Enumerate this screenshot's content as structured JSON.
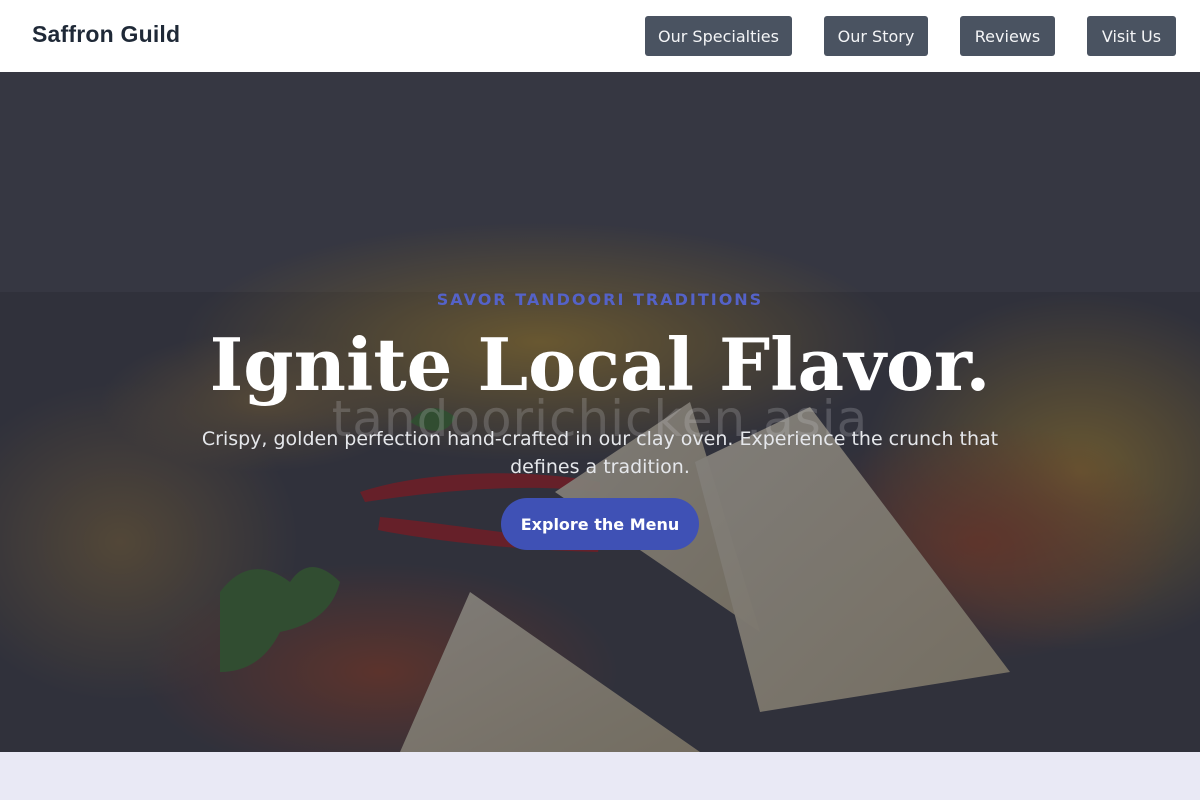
{
  "brand": {
    "name": "Saffron Guild"
  },
  "nav": {
    "items": [
      {
        "label": "Our Specialties"
      },
      {
        "label": "Our Story"
      },
      {
        "label": "Reviews"
      },
      {
        "label": "Visit Us"
      }
    ]
  },
  "hero": {
    "eyebrow": "SAVOR TANDOORI TRADITIONS",
    "title": "Ignite Local Flavor.",
    "subtitle": "Crispy, golden perfection hand-crafted in our clay oven. Experience the crunch that defines a tradition.",
    "cta_label": "Explore the Menu",
    "watermark": "tandoorichicken.asia"
  },
  "colors": {
    "accent": "#3f51b5",
    "eyebrow": "#5462c8",
    "nav_button": "#4a5361",
    "brand_text": "#1f2937",
    "lower_band": "#e9e9f5"
  }
}
